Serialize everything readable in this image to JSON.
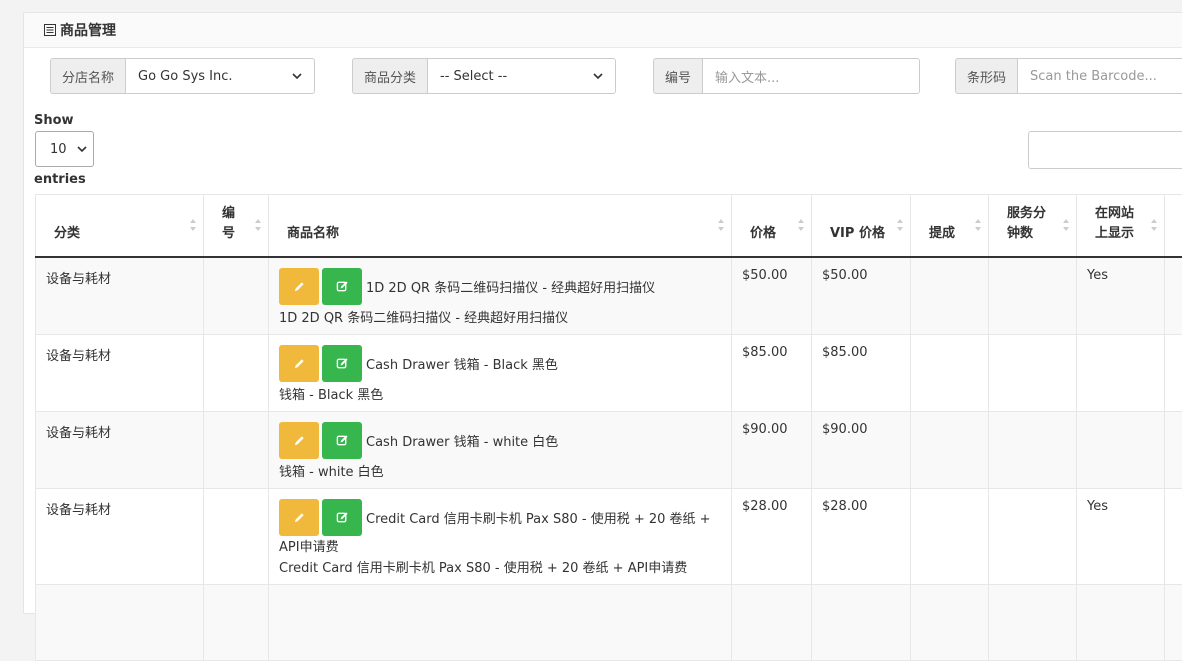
{
  "panel": {
    "title": "商品管理"
  },
  "filters": {
    "store": {
      "label": "分店名称",
      "value": "Go Go Sys Inc."
    },
    "category": {
      "label": "商品分类",
      "value": "-- Select --"
    },
    "code": {
      "label": "编号",
      "placeholder": "输入文本..."
    },
    "barcode": {
      "label": "条形码",
      "placeholder": "Scan the Barcode..."
    }
  },
  "length": {
    "show": "Show",
    "value": "10",
    "entries": "entries"
  },
  "table": {
    "headers": {
      "category": "分类",
      "code_1": "编",
      "code_2": "号",
      "name": "商品名称",
      "price": "价格",
      "vip_price": "VIP 价格",
      "commission": "提成",
      "service_1": "服务分",
      "service_2": "钟数",
      "web_1": "在网站",
      "web_2": "上显示"
    },
    "rows": [
      {
        "category": "设备与耗材",
        "code": "",
        "name": "1D 2D QR 条码二维码扫描仪 - 经典超好用扫描仪",
        "subtitle": "1D 2D QR 条码二维码扫描仪 - 经典超好用扫描仪",
        "price": "$50.00",
        "vip": "$50.00",
        "commission": "",
        "service": "",
        "web": "Yes"
      },
      {
        "category": "设备与耗材",
        "code": "",
        "name": "Cash Drawer 钱箱 - Black 黑色",
        "subtitle": "钱箱 - Black 黑色",
        "price": "$85.00",
        "vip": "$85.00",
        "commission": "",
        "service": "",
        "web": ""
      },
      {
        "category": "设备与耗材",
        "code": "",
        "name": "Cash Drawer 钱箱 - white 白色",
        "subtitle": "钱箱 - white 白色",
        "price": "$90.00",
        "vip": "$90.00",
        "commission": "",
        "service": "",
        "web": ""
      },
      {
        "category": "设备与耗材",
        "code": "",
        "name": "Credit Card 信用卡刷卡机 Pax S80 - 使用税 + 20 卷纸 +",
        "name_cont": "API申请费",
        "subtitle": "Credit Card 信用卡刷卡机 Pax S80 - 使用税 + 20 卷纸 + API申请费",
        "price": "$28.00",
        "vip": "$28.00",
        "commission": "",
        "service": "",
        "web": "Yes"
      }
    ]
  },
  "colors": {
    "edit_button": "#f0b93b",
    "detail_button": "#36b64d"
  },
  "icons": {
    "edit": "pencil-icon",
    "detail": "edit-square-icon",
    "title": "list-icon",
    "sort": "sort-icon"
  }
}
